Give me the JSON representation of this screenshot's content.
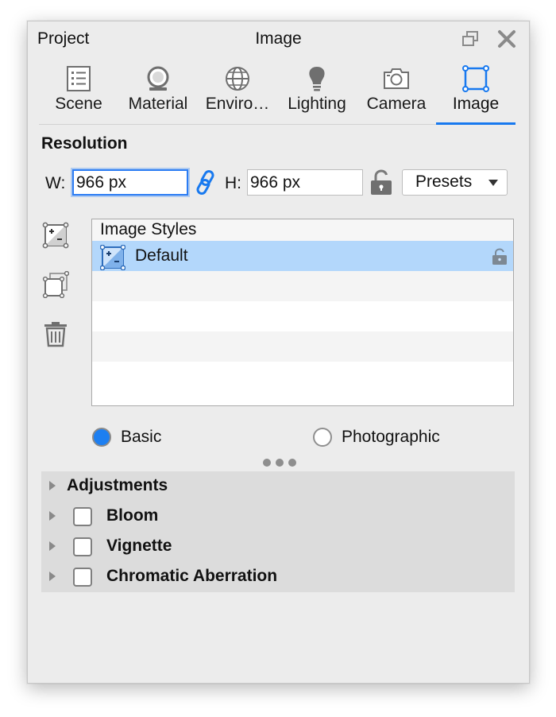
{
  "titlebar": {
    "left_label": "Project",
    "title": "Image"
  },
  "tabs": [
    {
      "label": "Scene",
      "icon": "scene-list-icon",
      "active": false
    },
    {
      "label": "Material",
      "icon": "material-ball-icon",
      "active": false
    },
    {
      "label": "Enviro…",
      "icon": "environment-globe-icon",
      "active": false
    },
    {
      "label": "Lighting",
      "icon": "lightbulb-icon",
      "active": false
    },
    {
      "label": "Camera",
      "icon": "camera-icon",
      "active": false
    },
    {
      "label": "Image",
      "icon": "image-frame-icon",
      "active": true
    }
  ],
  "resolution": {
    "title": "Resolution",
    "width_label": "W:",
    "width_value": "966 px",
    "height_label": "H:",
    "height_value": "966 px",
    "presets_label": "Presets"
  },
  "styles_list": {
    "header": "Image Styles",
    "items": [
      {
        "label": "Default",
        "selected": true,
        "locked": true
      }
    ]
  },
  "mode": {
    "basic_label": "Basic",
    "photographic_label": "Photographic",
    "selected": "basic"
  },
  "panel": {
    "adjustments_label": "Adjustments",
    "effects": [
      {
        "label": "Bloom",
        "checked": false
      },
      {
        "label": "Vignette",
        "checked": false
      },
      {
        "label": "Chromatic Aberration",
        "checked": false
      }
    ]
  },
  "colors": {
    "accent": "#1879ef",
    "selection": "#b3d7fb",
    "panel_bg": "#ececec",
    "section_bg": "#dcdcdc"
  }
}
